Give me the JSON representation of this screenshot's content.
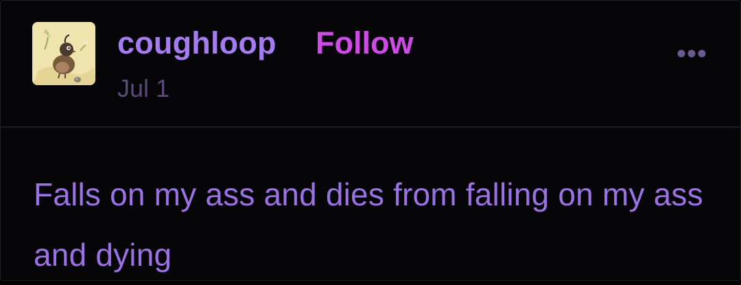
{
  "post": {
    "author": {
      "username": "coughloop",
      "follow_label": "Follow",
      "avatar_icon": "bird-avatar-icon"
    },
    "date": "Jul 1",
    "more_icon": "more-options-icon",
    "text": "Falls on my ass and dies from falling on my ass and dying"
  },
  "colors": {
    "background": "#060608",
    "username": "#a47cf0",
    "follow": "#d04ae8",
    "date": "#5a4a7a",
    "body_text": "#9b72e4",
    "more_icon": "#6a5a8e"
  }
}
